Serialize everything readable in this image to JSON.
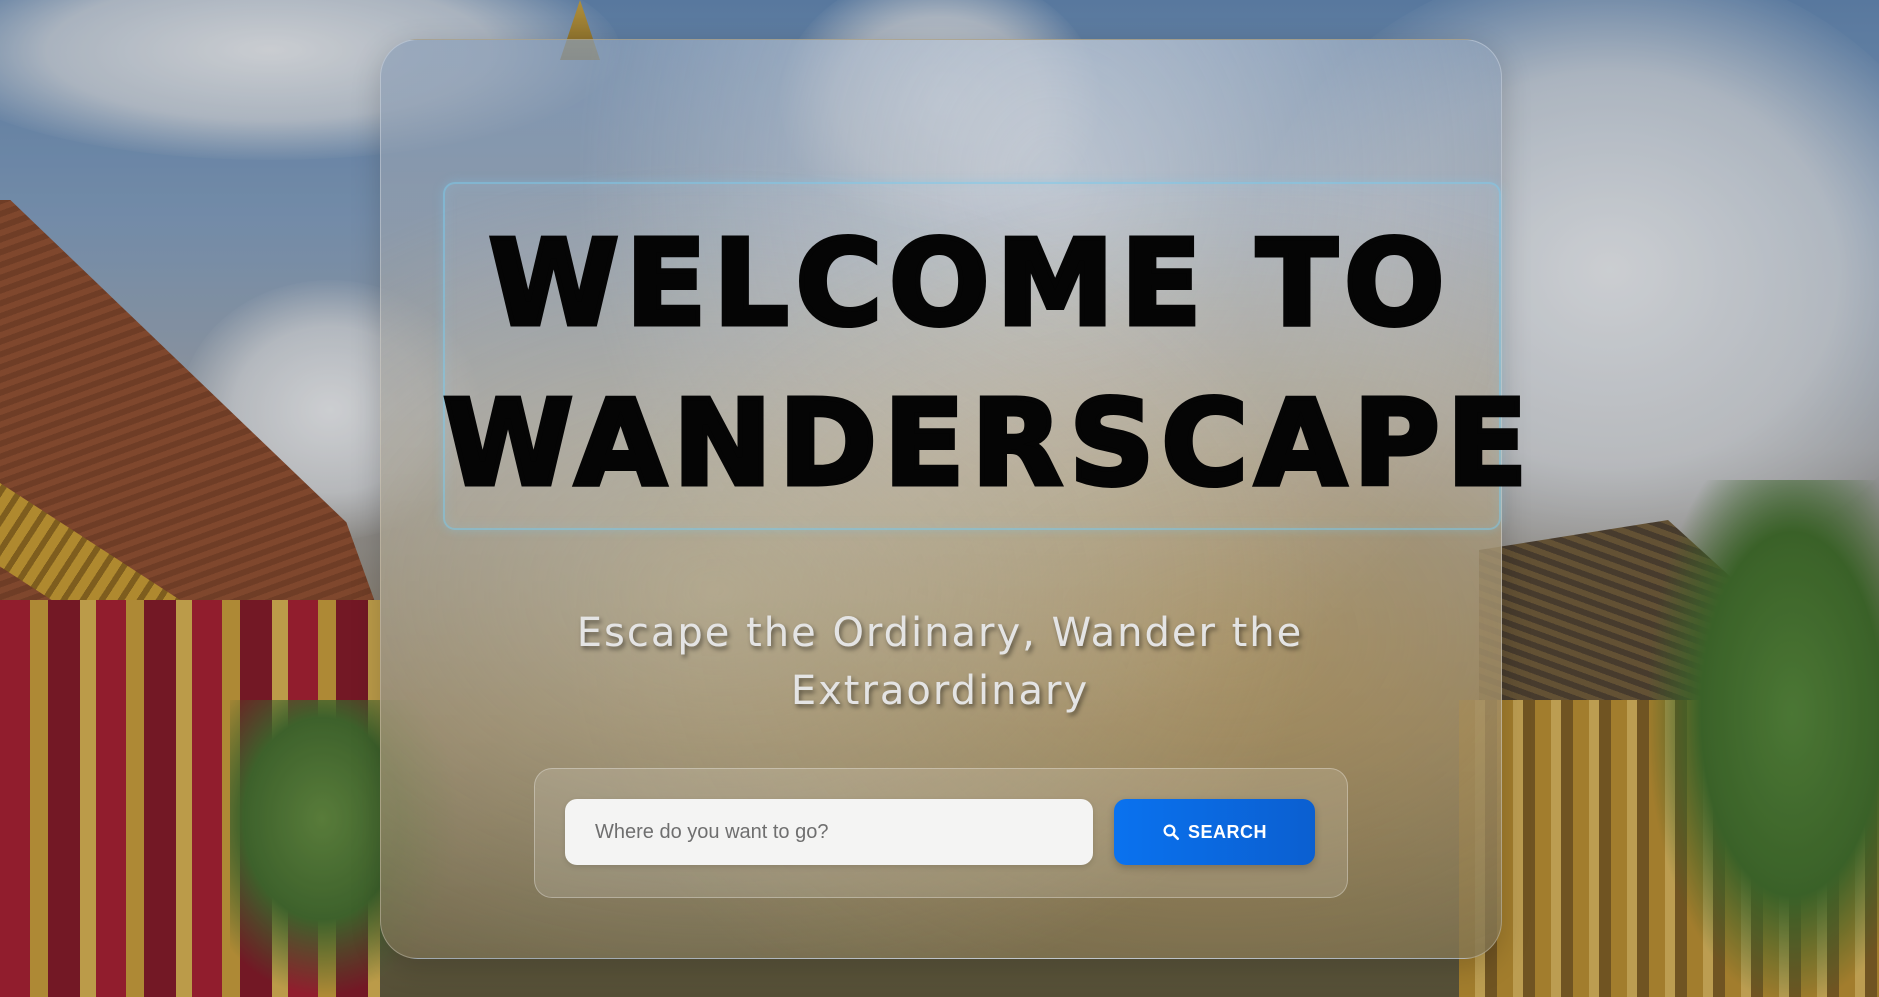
{
  "hero": {
    "title_line1": "WELCOME TO",
    "title_line2": "WANDERSCAPE",
    "tagline": "Escape the Ordinary, Wander the Extraordinary"
  },
  "search": {
    "placeholder": "Where do you want to go?",
    "value": "",
    "button_label": "SEARCH",
    "button_icon": "search-icon"
  },
  "colors": {
    "accent": "#0a72ef",
    "title": "#050505",
    "tagline": "#e4e4e4",
    "title_border": "#78c8eb"
  }
}
